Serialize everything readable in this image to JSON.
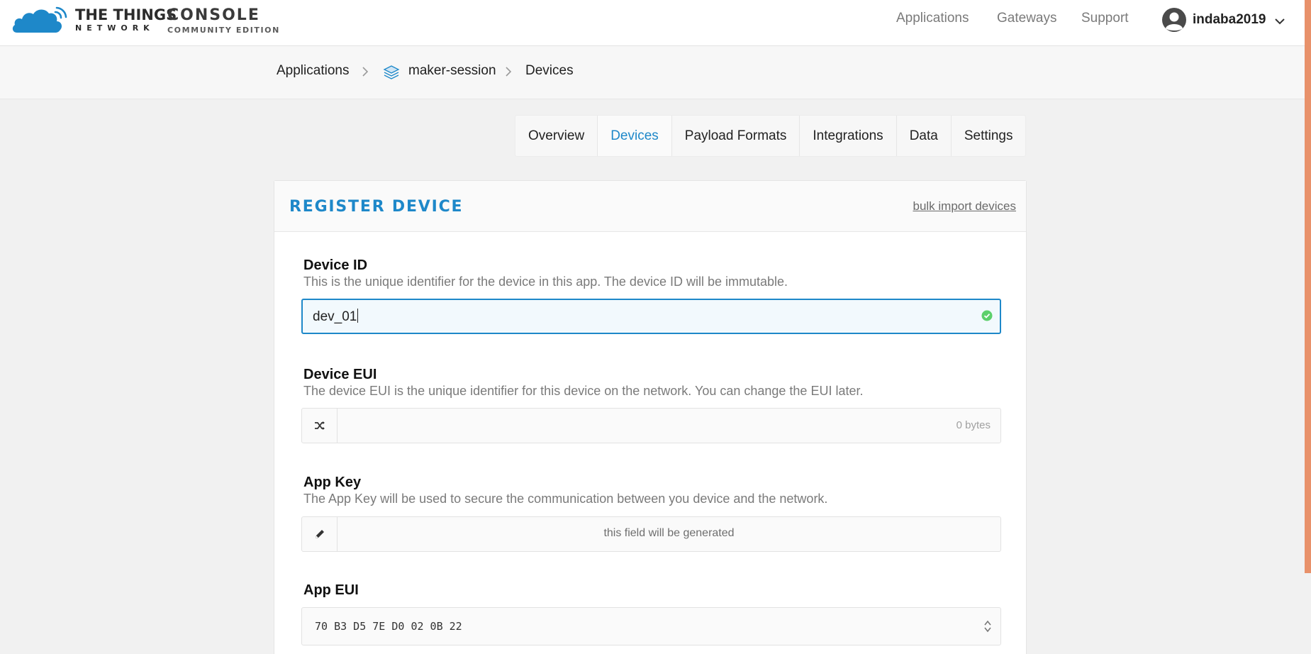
{
  "header": {
    "brand_line1": "THE THINGS",
    "brand_line2": "NETWORK",
    "console_title": "CONSOLE",
    "console_subtitle": "COMMUNITY EDITION",
    "nav": [
      "Applications",
      "Gateways",
      "Support"
    ],
    "username": "indaba2019"
  },
  "breadcrumb": {
    "applications": "Applications",
    "app": "maker-session",
    "current": "Devices"
  },
  "tabs": [
    {
      "label": "Overview",
      "active": false
    },
    {
      "label": "Devices",
      "active": true
    },
    {
      "label": "Payload Formats",
      "active": false
    },
    {
      "label": "Integrations",
      "active": false
    },
    {
      "label": "Data",
      "active": false
    },
    {
      "label": "Settings",
      "active": false
    }
  ],
  "card": {
    "title": "REGISTER DEVICE",
    "bulk_link": "bulk import devices"
  },
  "form": {
    "device_id": {
      "label": "Device ID",
      "help": "This is the unique identifier for the device in this app. The device ID will be immutable.",
      "value": "dev_01"
    },
    "device_eui": {
      "label": "Device EUI",
      "help": "The device EUI is the unique identifier for this device on the network. You can change the EUI later.",
      "value": "",
      "bytes": "0 bytes"
    },
    "app_key": {
      "label": "App Key",
      "help": "The App Key will be used to secure the communication between you device and the network.",
      "placeholder": "this field will be generated"
    },
    "app_eui": {
      "label": "App EUI",
      "value": "70 B3 D5 7E D0 02 0B 22"
    }
  },
  "colors": {
    "accent": "#1e88c9",
    "brand_cloud": "#1e88c9",
    "valid": "#5cd06b",
    "scrollbar": "#e8916a"
  },
  "icons": [
    "ttn-cloud-logo",
    "user-avatar-icon",
    "chevron-down-icon",
    "chevron-right-icon",
    "layers-icon",
    "check-circle-icon",
    "shuffle-icon",
    "pencil-icon",
    "spinner-arrows-icon"
  ]
}
